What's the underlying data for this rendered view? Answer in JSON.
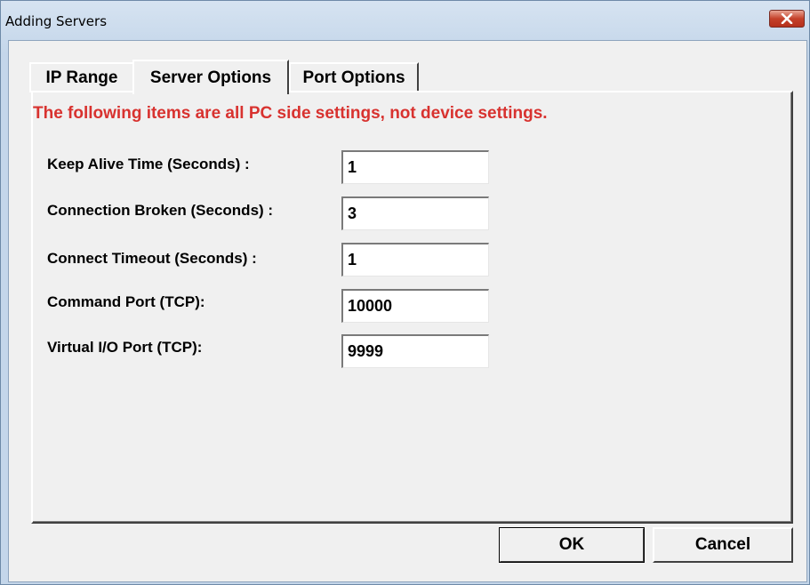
{
  "window": {
    "title": "Adding Servers",
    "close_icon": "close-x-icon"
  },
  "tabs": [
    {
      "label": "IP Range",
      "active": false
    },
    {
      "label": "Server Options",
      "active": true
    },
    {
      "label": "Port Options",
      "active": false
    }
  ],
  "note": "The following items are all PC side settings, not device settings.",
  "fields": {
    "keep_alive": {
      "label": "Keep Alive Time (Seconds) :",
      "value": "1"
    },
    "connection_broken": {
      "label": "Connection Broken (Seconds) :",
      "value": "3"
    },
    "connect_timeout": {
      "label": "Connect Timeout (Seconds) :",
      "value": "1"
    },
    "command_port": {
      "label": "Command Port (TCP):",
      "value": "10000"
    },
    "virtual_io_port": {
      "label": "Virtual I/O Port (TCP):",
      "value": "9999"
    }
  },
  "buttons": {
    "ok": "OK",
    "cancel": "Cancel"
  },
  "colors": {
    "note_text": "#d8322f",
    "close_button": "#c5412a"
  }
}
